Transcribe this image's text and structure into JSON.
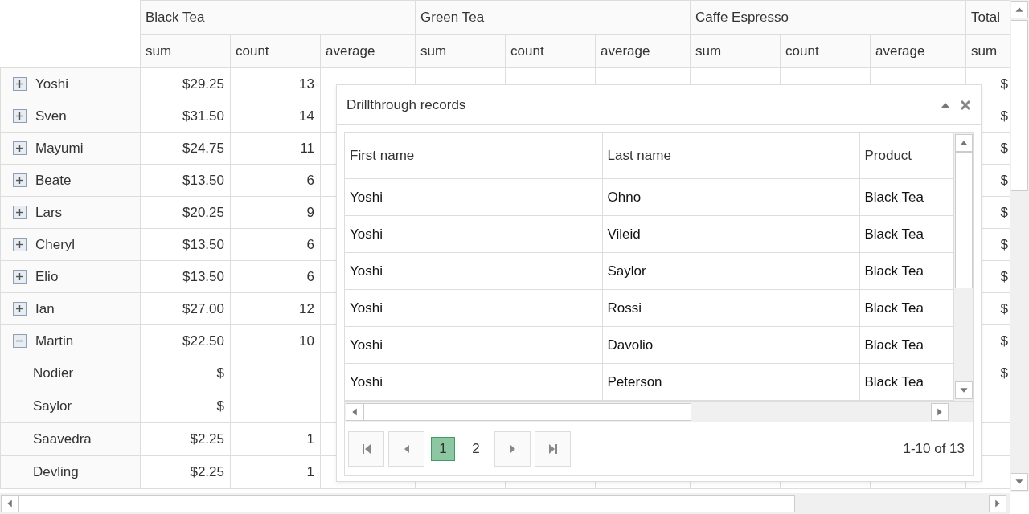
{
  "pivot": {
    "column_groups": [
      {
        "label": "Black Tea",
        "measures": [
          "sum",
          "count",
          "average"
        ]
      },
      {
        "label": "Green Tea",
        "measures": [
          "sum",
          "count",
          "average"
        ]
      },
      {
        "label": "Caffe Espresso",
        "measures": [
          "sum",
          "count",
          "average"
        ]
      },
      {
        "label": "Total",
        "measures": [
          "sum"
        ]
      }
    ],
    "rows": [
      {
        "label": "Yoshi",
        "expanded": false,
        "cells": [
          "$29.25",
          "13",
          null,
          null,
          null,
          null,
          null,
          null,
          null,
          "$"
        ]
      },
      {
        "label": "Sven",
        "expanded": false,
        "cells": [
          "$31.50",
          "14",
          null,
          null,
          null,
          null,
          null,
          null,
          null,
          "$"
        ]
      },
      {
        "label": "Mayumi",
        "expanded": false,
        "cells": [
          "$24.75",
          "11",
          null,
          null,
          null,
          null,
          null,
          null,
          null,
          "$"
        ]
      },
      {
        "label": "Beate",
        "expanded": false,
        "cells": [
          "$13.50",
          "6",
          null,
          null,
          null,
          null,
          null,
          null,
          null,
          "$"
        ]
      },
      {
        "label": "Lars",
        "expanded": false,
        "cells": [
          "$20.25",
          "9",
          null,
          null,
          null,
          null,
          null,
          null,
          null,
          "$"
        ]
      },
      {
        "label": "Cheryl",
        "expanded": false,
        "cells": [
          "$13.50",
          "6",
          null,
          null,
          null,
          null,
          null,
          null,
          null,
          "$"
        ]
      },
      {
        "label": "Elio",
        "expanded": false,
        "cells": [
          "$13.50",
          "6",
          null,
          null,
          null,
          null,
          null,
          null,
          null,
          "$"
        ]
      },
      {
        "label": "Ian",
        "expanded": false,
        "cells": [
          "$27.00",
          "12",
          null,
          null,
          null,
          null,
          null,
          null,
          null,
          "$"
        ]
      },
      {
        "label": "Martin",
        "expanded": true,
        "cells": [
          "$22.50",
          "10",
          null,
          null,
          null,
          null,
          null,
          null,
          null,
          "$"
        ],
        "children": [
          {
            "label": "Nodier",
            "cells": [
              "$",
              null,
              null,
              null,
              null,
              null,
              null,
              null,
              null,
              "$"
            ]
          },
          {
            "label": "Saylor",
            "cells": [
              "$",
              null,
              null,
              null,
              null,
              null,
              null,
              null,
              null,
              null
            ]
          },
          {
            "label": "Saavedra",
            "cells": [
              "$2.25",
              "1",
              null,
              null,
              null,
              null,
              null,
              null,
              null,
              null
            ]
          },
          {
            "label": "Devling",
            "cells": [
              "$2.25",
              "1",
              null,
              null,
              null,
              null,
              null,
              null,
              null,
              null
            ]
          }
        ]
      }
    ]
  },
  "dialog": {
    "title": "Drillthrough records",
    "columns": [
      "First name",
      "Last name",
      "Product"
    ],
    "rows": [
      [
        "Yoshi",
        "Ohno",
        "Black Tea"
      ],
      [
        "Yoshi",
        "Vileid",
        "Black Tea"
      ],
      [
        "Yoshi",
        "Saylor",
        "Black Tea"
      ],
      [
        "Yoshi",
        "Rossi",
        "Black Tea"
      ],
      [
        "Yoshi",
        "Davolio",
        "Black Tea"
      ],
      [
        "Yoshi",
        "Peterson",
        "Black Tea"
      ]
    ],
    "pages": [
      {
        "label": "1",
        "selected": true
      },
      {
        "label": "2",
        "selected": false
      }
    ],
    "summary": "1-10 of 13"
  }
}
